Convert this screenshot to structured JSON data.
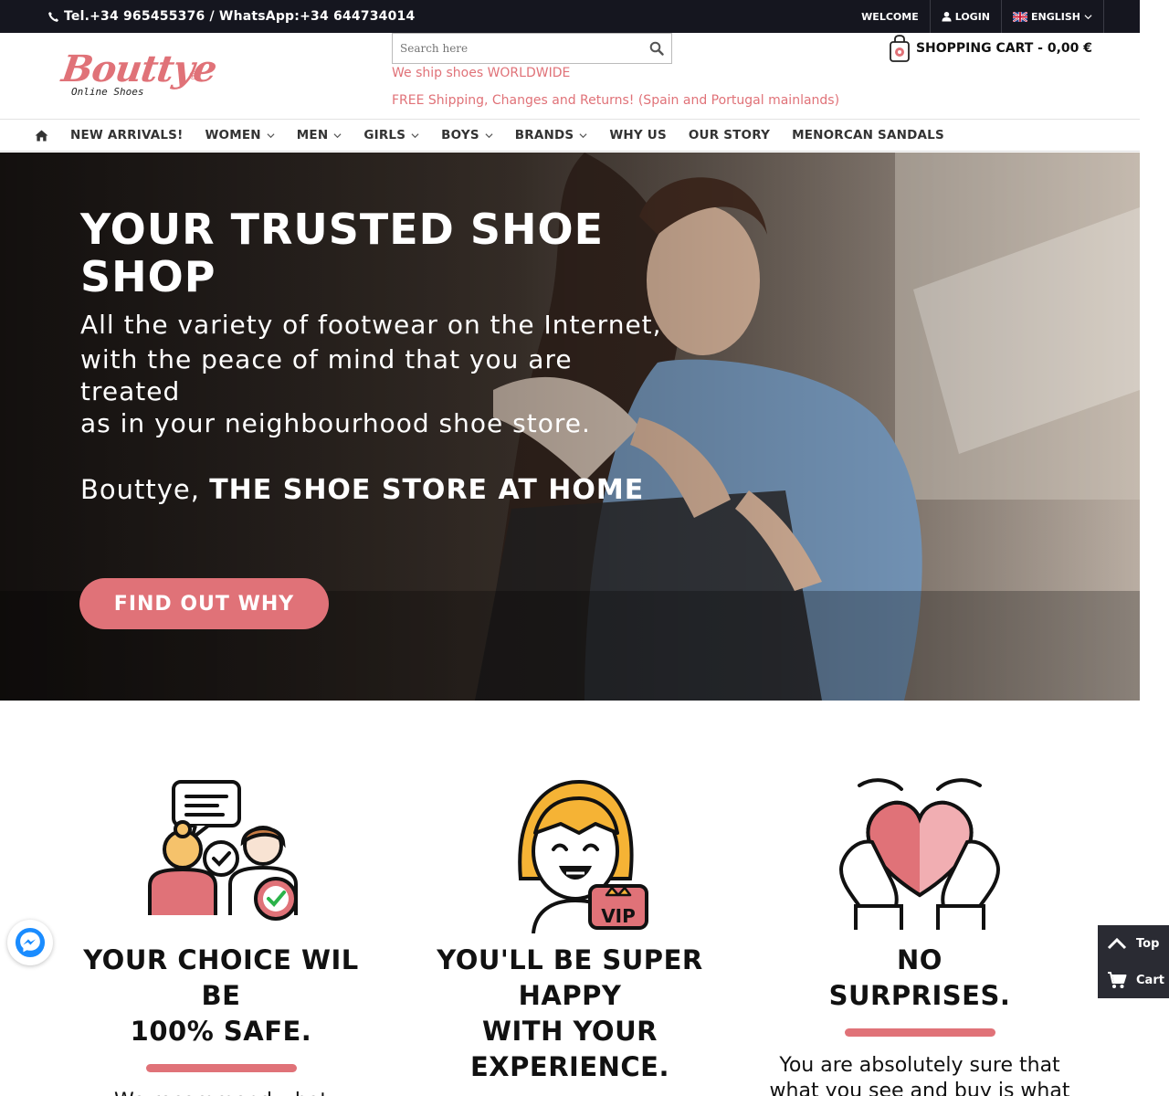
{
  "topbar": {
    "phone": "Tel.+34 965455376 / WhatsApp:+34 644734014",
    "welcome": "WELCOME",
    "login": "LOGIN",
    "language": "ENGLISH"
  },
  "header": {
    "logo_brand": "Bouttye",
    "logo_reg": "®",
    "logo_tagline": "Online Shoes",
    "search_placeholder": "Search here",
    "ship_worldwide": "We ship shoes WORLDWIDE",
    "free_shipping": "FREE Shipping, Changes and Returns! (Spain and Portugal mainlands)",
    "cart_label": "SHOPPING CART - 0,00 €"
  },
  "nav": {
    "items": [
      {
        "label": "NEW ARRIVALS!"
      },
      {
        "label": "WOMEN"
      },
      {
        "label": "MEN"
      },
      {
        "label": "GIRLS"
      },
      {
        "label": "BOYS"
      },
      {
        "label": "BRANDS"
      },
      {
        "label": "WHY US"
      },
      {
        "label": "OUR STORY"
      },
      {
        "label": "MENORCAN SANDALS"
      }
    ]
  },
  "hero": {
    "title": "YOUR TRUSTED SHOE SHOP",
    "sub_line1": "All the variety of footwear on the Internet,",
    "sub_line2": "with the peace of mind that you are",
    "sub_line3": "treated",
    "sub_line4": "as in your neighbourhood shoe store.",
    "tagline_prefix": "Bouttye,",
    "tagline_bold": "THE SHOE STORE AT HOME",
    "cta": "FIND OUT WHY"
  },
  "features": [
    {
      "title_l1": "YOUR CHOICE WIL",
      "title_l2": "BE",
      "title_l3": "100% SAFE.",
      "text": "We recommend what"
    },
    {
      "title_l1": "YOU'LL BE SUPER",
      "title_l2": "HAPPY",
      "title_l3": "WITH YOUR",
      "title_l4": "EXPERIENCE.",
      "badge": "VIP"
    },
    {
      "title_l1": "NO",
      "title_l2": "SURPRISES.",
      "text_l1": "You are absolutely sure that",
      "text_l2": "what you see and buy is what"
    }
  ],
  "floating": {
    "top_label": "Top",
    "cart_label": "Cart"
  },
  "colors": {
    "accent": "#e07278",
    "topbar_bg": "#15161f"
  }
}
